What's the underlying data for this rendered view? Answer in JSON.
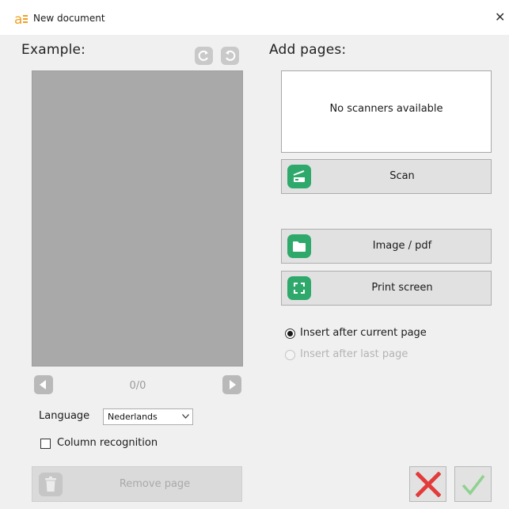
{
  "window": {
    "title": "New document",
    "app_icon": "a-logo-icon",
    "close_glyph": "✕"
  },
  "left_panel": {
    "heading": "Example:",
    "rotate_left_icon": "rotate-left-icon",
    "rotate_right_icon": "rotate-right-icon",
    "page_counter": "0/0",
    "language_label": "Language",
    "language_value": "Nederlands",
    "column_recognition_label": "Column recognition",
    "column_recognition_checked": false,
    "remove_page_label": "Remove page"
  },
  "right_panel": {
    "heading": "Add pages:",
    "scanner_status": "No scanners available",
    "buttons": [
      {
        "label": "Scan",
        "icon": "scanner-icon"
      },
      {
        "label": "Image / pdf",
        "icon": "folder-icon"
      },
      {
        "label": "Print screen",
        "icon": "screen-capture-icon"
      }
    ],
    "insert_options": [
      {
        "label": "Insert after current page",
        "selected": true,
        "enabled": true
      },
      {
        "label": "Insert after last page",
        "selected": false,
        "enabled": false
      }
    ]
  },
  "footer": {
    "cancel_icon": "cancel-x-icon",
    "ok_icon": "check-icon"
  },
  "colors": {
    "accent_green": "#2ea96b",
    "cancel_red": "#e23b3b",
    "ok_green": "#8fd18f",
    "dialog_background": "#f0f0f0"
  }
}
